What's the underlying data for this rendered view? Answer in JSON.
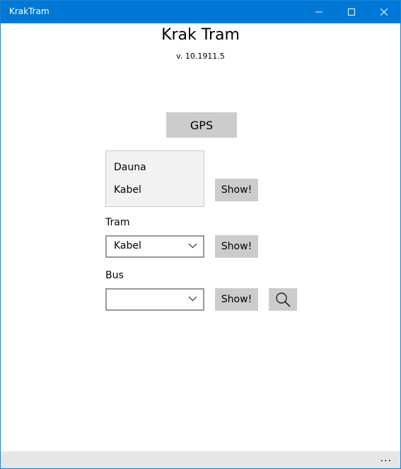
{
  "window": {
    "title": "KrakTram",
    "accent_color": "#0078d7"
  },
  "header": {
    "app_title": "Krak Tram",
    "version": "v. 10.1911.5"
  },
  "gps": {
    "label": "GPS"
  },
  "stops_list": {
    "items": [
      "Dauna",
      "Kabel"
    ],
    "show_label": "Show!"
  },
  "tram": {
    "label": "Tram",
    "selected": "Kabel",
    "show_label": "Show!"
  },
  "bus": {
    "label": "Bus",
    "selected": "",
    "show_label": "Show!",
    "search_icon": "search-icon"
  },
  "appbar": {
    "more_label": "..."
  }
}
